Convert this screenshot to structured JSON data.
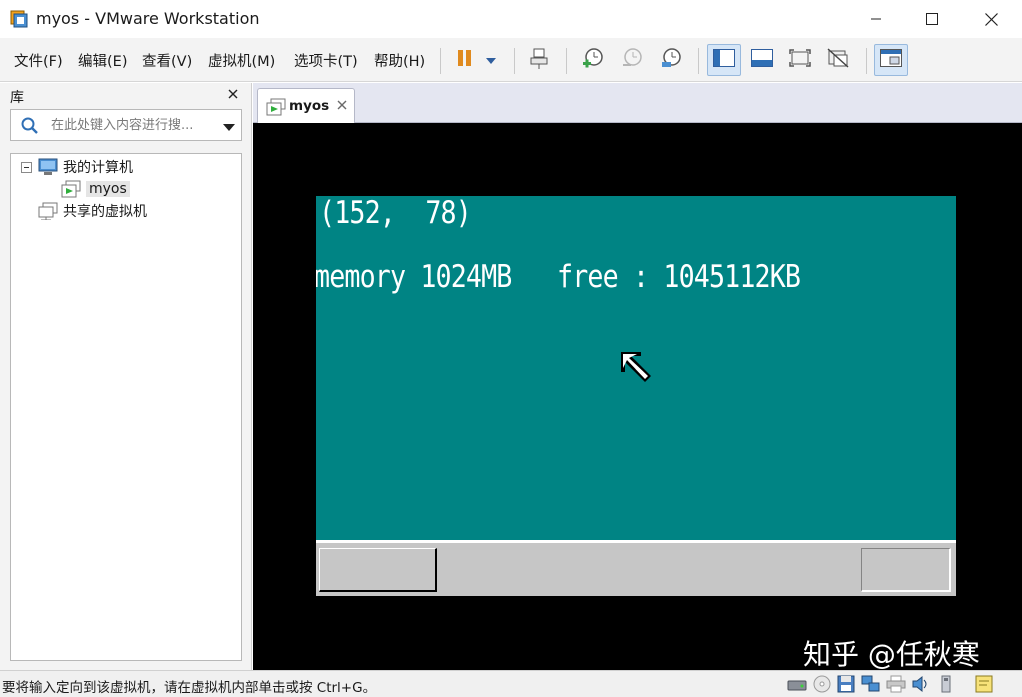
{
  "window": {
    "title": "myos - VMware Workstation",
    "minimize_icon": "minimize-icon",
    "maximize_icon": "maximize-icon",
    "close_icon": "close-icon"
  },
  "menu": {
    "items": [
      "文件(F)",
      "编辑(E)",
      "查看(V)",
      "虚拟机(M)",
      "选项卡(T)",
      "帮助(H)"
    ]
  },
  "toolbar": {
    "icons": [
      "pause-icon",
      "dropdown-arrow-icon",
      "send-ctrl-alt-del-icon",
      "snapshot-take-icon",
      "snapshot-revert-icon",
      "snapshot-manager-icon",
      "show-library-icon",
      "show-thumbnail-icon",
      "full-screen-icon",
      "unity-icon",
      "console-view-icon"
    ]
  },
  "library": {
    "title": "库",
    "search_placeholder": "在此处键入内容进行搜...",
    "tree": [
      {
        "label": "我的计算机",
        "icon": "computer-icon",
        "expanded": true
      },
      {
        "label": "myos",
        "icon": "vm-running-icon",
        "selected": true
      },
      {
        "label": "共享的虚拟机",
        "icon": "shared-vms-icon"
      }
    ]
  },
  "tabs": [
    {
      "label": "myos",
      "icon": "vm-running-icon",
      "active": true
    }
  ],
  "vm": {
    "mouse_coords": "(152,  78)",
    "memory_line": "memory 1024MB   free : 1045112KB",
    "colors": {
      "desktop": "#008484",
      "taskbar": "#c6c6c6"
    }
  },
  "watermark": "知乎 @任秋寒",
  "statusbar": {
    "message": "要将输入定向到该虚拟机，请在虚拟机内部单击或按 Ctrl+G。",
    "icons": [
      "hard-disk-icon",
      "cd-dvd-icon",
      "floppy-icon",
      "network-adapter-icon",
      "printer-icon",
      "sound-icon",
      "usb-icon",
      "message-log-icon"
    ]
  }
}
